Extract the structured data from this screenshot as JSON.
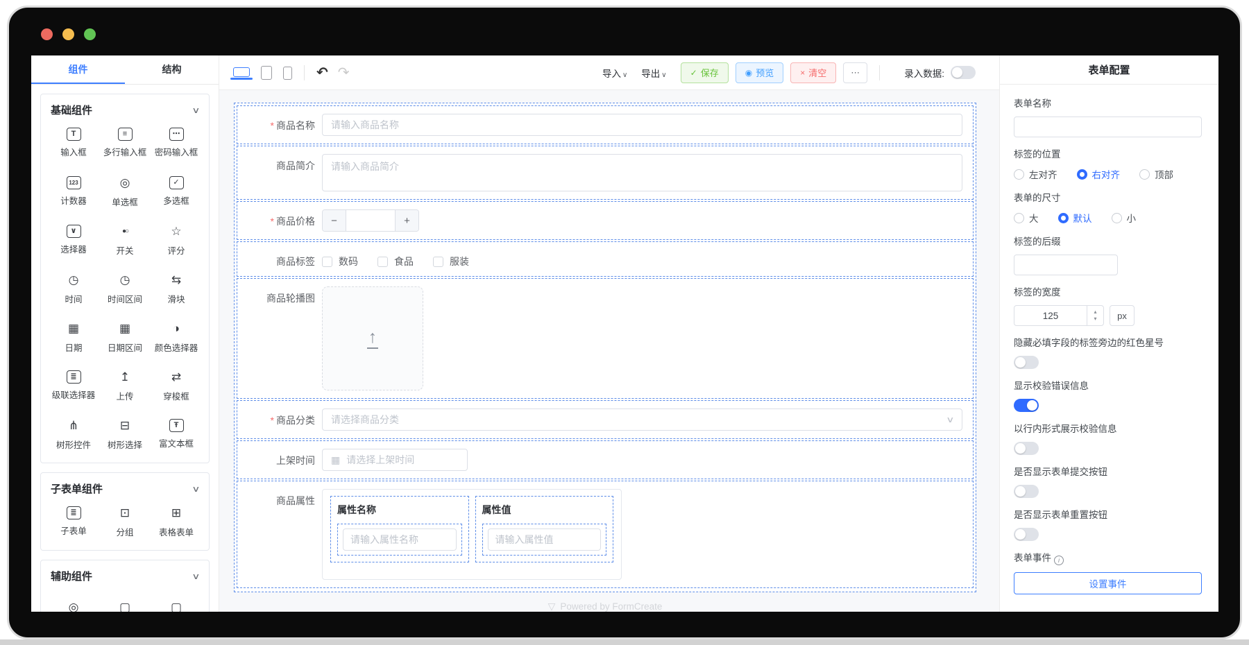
{
  "colors": {
    "accent": "#3d7eff",
    "success": "#67c23a",
    "info_blue": "#409eff",
    "danger": "#f56c6c",
    "traffic_red": "#ed6a5f",
    "traffic_yellow": "#f5bd4f",
    "traffic_green": "#61c454"
  },
  "icons": {
    "chevron_down": "∨",
    "save": "✓",
    "eye": "◉",
    "trash": "×",
    "more": "⋯",
    "undo": "↶",
    "redo": "↷",
    "upload_arrow": "↑",
    "calendar": "▦",
    "info": "i",
    "spinner_up": "▴",
    "spinner_down": "▾",
    "minus": "−",
    "plus": "+",
    "watermark_logo": "▽"
  },
  "sidebar": {
    "tabs": [
      {
        "name": "components",
        "label": "组件",
        "active": true
      },
      {
        "name": "structure",
        "label": "结构",
        "active": false
      }
    ],
    "groups": [
      {
        "name": "basic",
        "title": "基础组件",
        "items": [
          {
            "name": "input",
            "label": "输入框",
            "glyph": "T",
            "boxed": true
          },
          {
            "name": "textarea",
            "label": "多行输入框",
            "glyph": "≡",
            "boxed": true
          },
          {
            "name": "password",
            "label": "密码输入框",
            "glyph": "⋯",
            "boxed": true
          },
          {
            "name": "counter",
            "label": "计数器",
            "glyph": "123",
            "boxed": true,
            "tiny": true
          },
          {
            "name": "radio",
            "label": "单选框",
            "glyph": "◎"
          },
          {
            "name": "checkbox",
            "label": "多选框",
            "glyph": "✓",
            "boxed": true
          },
          {
            "name": "select",
            "label": "选择器",
            "glyph": "∨",
            "boxed": true
          },
          {
            "name": "switch",
            "label": "开关",
            "glyph": "●○",
            "pair": true
          },
          {
            "name": "rate",
            "label": "评分",
            "glyph": "☆"
          },
          {
            "name": "time",
            "label": "时间",
            "glyph": "◷"
          },
          {
            "name": "time-range",
            "label": "时间区间",
            "glyph": "◷"
          },
          {
            "name": "slider",
            "label": "滑块",
            "glyph": "⇆"
          },
          {
            "name": "date",
            "label": "日期",
            "glyph": "▦"
          },
          {
            "name": "date-range",
            "label": "日期区间",
            "glyph": "▦"
          },
          {
            "name": "color-picker",
            "label": "颜色选择器",
            "glyph": "◑"
          },
          {
            "name": "cascader",
            "label": "级联选择器",
            "glyph": "≣",
            "boxed": true
          },
          {
            "name": "upload",
            "label": "上传",
            "glyph": "↥"
          },
          {
            "name": "transfer",
            "label": "穿梭框",
            "glyph": "⇄"
          },
          {
            "name": "tree",
            "label": "树形控件",
            "glyph": "⋔"
          },
          {
            "name": "tree-select",
            "label": "树形选择",
            "glyph": "⊟"
          },
          {
            "name": "rich-text",
            "label": "富文本框",
            "glyph": "Ŧ",
            "boxed": true
          }
        ]
      },
      {
        "name": "subform",
        "title": "子表单组件",
        "items": [
          {
            "name": "sub-form",
            "label": "子表单",
            "glyph": "≣",
            "boxed": true
          },
          {
            "name": "group",
            "label": "分组",
            "glyph": "⊡"
          },
          {
            "name": "table-form",
            "label": "表格表单",
            "glyph": "⊞"
          }
        ]
      },
      {
        "name": "auxiliary",
        "title": "辅助组件",
        "items": [
          {
            "name": "aux-1",
            "label": "",
            "glyph": "◎"
          },
          {
            "name": "aux-2",
            "label": "",
            "glyph": "▢"
          },
          {
            "name": "aux-3",
            "label": "",
            "glyph": "▢"
          }
        ]
      }
    ]
  },
  "toolbar": {
    "import_label": "导入",
    "export_label": "导出",
    "save_label": "保存",
    "preview_label": "预览",
    "clear_label": "清空",
    "more_label": "⋯",
    "record_label": "录入数据:",
    "record_toggle_on": false
  },
  "form": {
    "rows": [
      {
        "name": "product-name",
        "type": "input",
        "label": "商品名称",
        "required": true,
        "placeholder": "请输入商品名称"
      },
      {
        "name": "product-intro",
        "type": "textarea",
        "label": "商品简介",
        "required": false,
        "placeholder": "请输入商品简介"
      },
      {
        "name": "product-price",
        "type": "number",
        "label": "商品价格",
        "required": true,
        "value": ""
      },
      {
        "name": "product-tags",
        "type": "checkbox",
        "label": "商品标签",
        "required": false,
        "options": [
          "数码",
          "食品",
          "服装"
        ]
      },
      {
        "name": "product-carousel",
        "type": "upload",
        "label": "商品轮播图",
        "required": false
      },
      {
        "name": "product-category",
        "type": "select",
        "label": "商品分类",
        "required": true,
        "placeholder": "请选择商品分类"
      },
      {
        "name": "launch-time",
        "type": "date",
        "label": "上架时间",
        "required": false,
        "placeholder": "请选择上架时间"
      },
      {
        "name": "product-attrs",
        "type": "subform",
        "label": "商品属性",
        "required": false,
        "columns": [
          {
            "name": "attr-name",
            "title": "属性名称",
            "placeholder": "请输入属性名称"
          },
          {
            "name": "attr-value",
            "title": "属性值",
            "placeholder": "请输入属性值"
          }
        ]
      }
    ],
    "watermark": "Powered by FormCreate"
  },
  "config_panel": {
    "title": "表单配置",
    "form_name_label": "表单名称",
    "form_name_value": "",
    "label_position": {
      "label": "标签的位置",
      "options": [
        "左对齐",
        "右对齐",
        "顶部"
      ],
      "selected": "右对齐"
    },
    "form_size": {
      "label": "表单的尺寸",
      "options": [
        "大",
        "默认",
        "小"
      ],
      "selected": "默认"
    },
    "label_suffix_label": "标签的后缀",
    "label_suffix_value": "",
    "label_width_label": "标签的宽度",
    "label_width_value": "125",
    "label_width_unit": "px",
    "toggles": [
      {
        "name": "hide-required-star",
        "label": "隐藏必填字段的标签旁边的红色星号",
        "on": false
      },
      {
        "name": "show-validation-error",
        "label": "显示校验错误信息",
        "on": true
      },
      {
        "name": "inline-validation",
        "label": "以行内形式展示校验信息",
        "on": false
      },
      {
        "name": "show-submit-button",
        "label": "是否显示表单提交按钮",
        "on": false
      },
      {
        "name": "show-reset-button",
        "label": "是否显示表单重置按钮",
        "on": false
      }
    ],
    "form_event_label": "表单事件",
    "set_event_button": "设置事件"
  }
}
